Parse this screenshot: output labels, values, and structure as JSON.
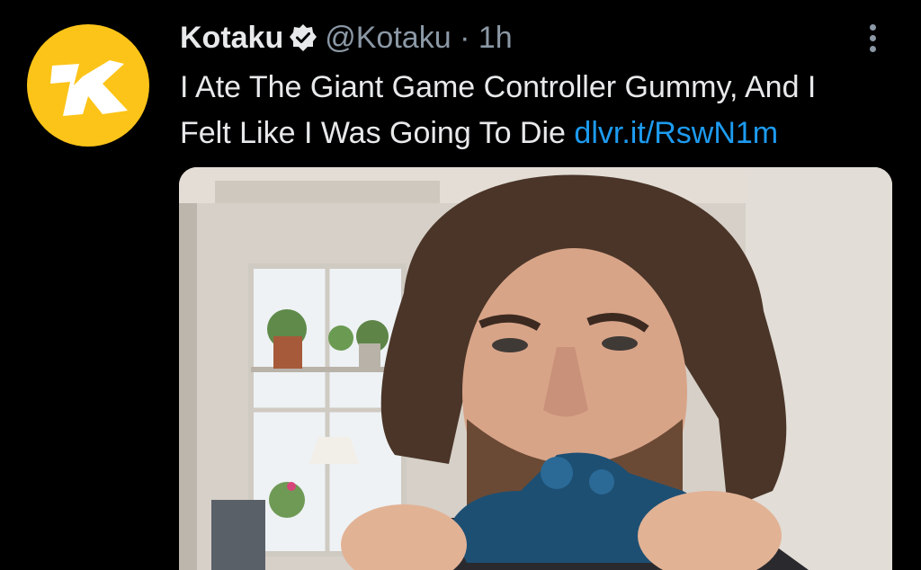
{
  "tweet": {
    "author_name": "Kotaku",
    "handle": "@Kotaku",
    "separator": "·",
    "timestamp": "1h",
    "text_line1": "I Ate The Giant Game Controller Gummy, And I",
    "text_line2": "Felt Like I Was Going To Die ",
    "link": "dlvr.it/RswN1m",
    "avatar_letter": "K",
    "icons": {
      "verified": "verified-badge-icon",
      "more": "more-vertical-icon"
    }
  },
  "colors": {
    "accent_link": "#1d9bf0",
    "avatar_bg": "#fcc419",
    "muted": "#8b98a5"
  }
}
